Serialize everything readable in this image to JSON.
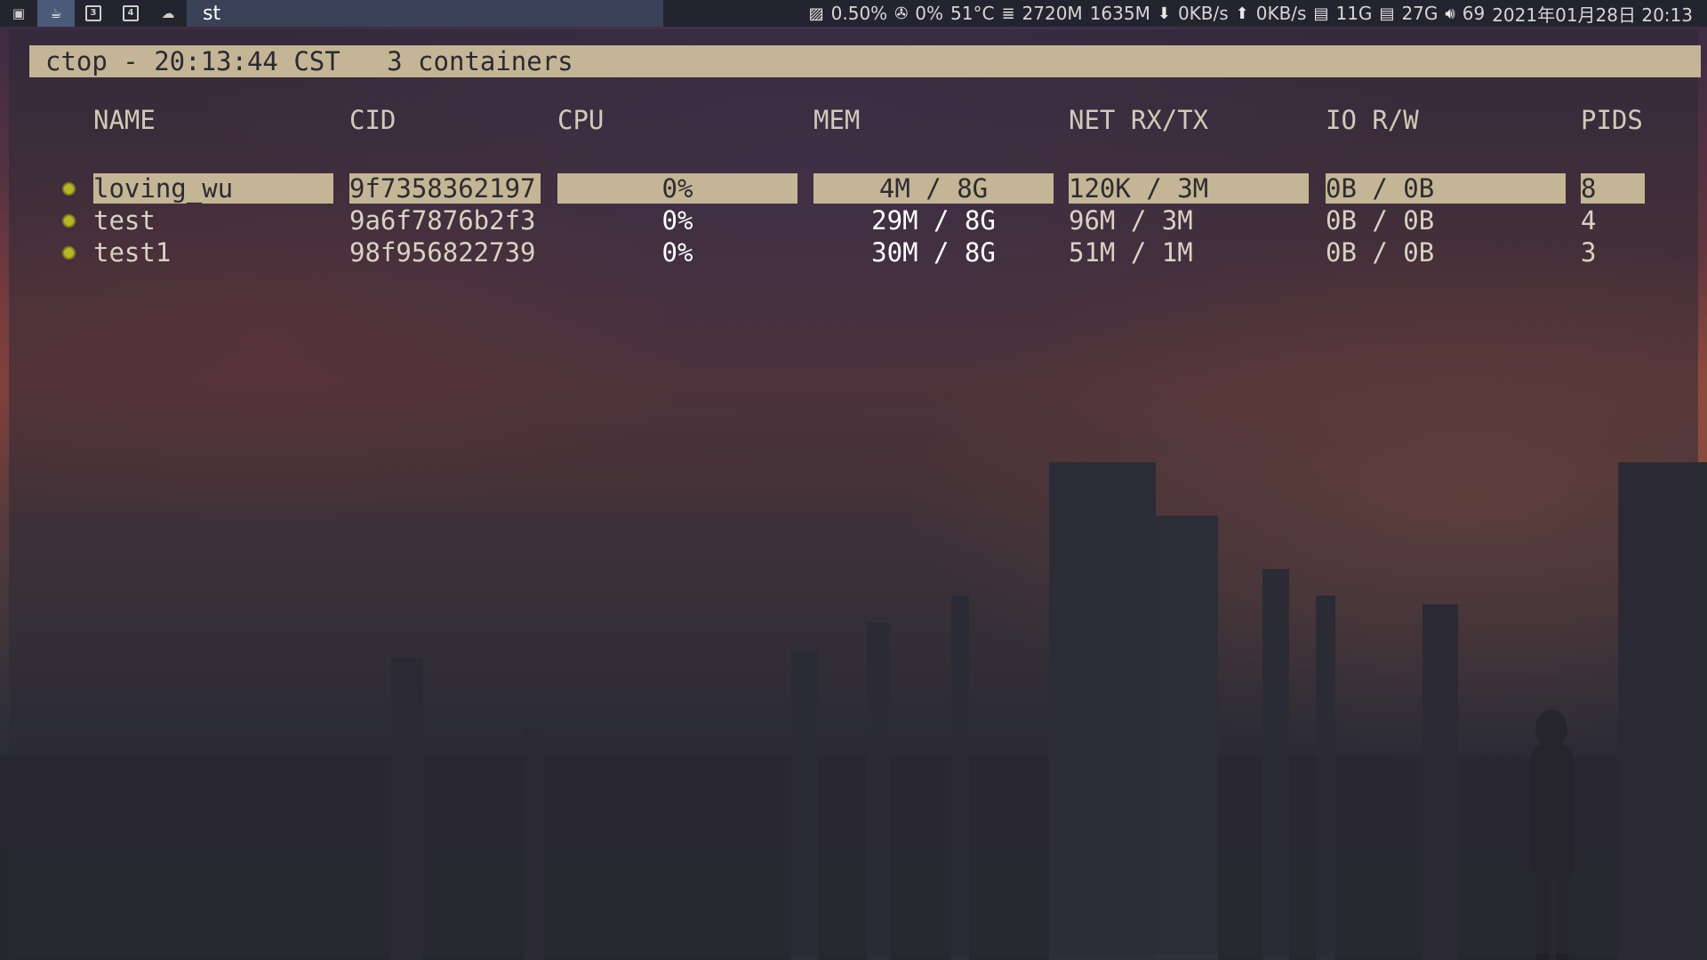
{
  "topbar": {
    "tags": [
      {
        "icon": "terminal-icon",
        "label": ""
      },
      {
        "icon": "coffee-icon",
        "label": "",
        "active": true
      },
      {
        "icon": "tag-3-icon",
        "label": "3"
      },
      {
        "icon": "tag-4-icon",
        "label": "4"
      },
      {
        "icon": "cloud-icon",
        "label": ""
      }
    ],
    "window_title": "st",
    "status": {
      "cpu": "0.50%",
      "fan": "0%",
      "temp": "51°C",
      "mem_used": "2720M",
      "mem_avail": "1635M",
      "net_down": "0KB/s",
      "net_up": "0KB/s",
      "disk1": "11G",
      "disk2": "27G",
      "volume": "69",
      "datetime": "2021年01月28日 20:13"
    }
  },
  "ctop": {
    "header": "ctop - 20:13:44 CST   3 containers",
    "columns": [
      "NAME",
      "CID",
      "CPU",
      "MEM",
      "NET RX/TX",
      "IO R/W",
      "PIDS"
    ],
    "rows": [
      {
        "name": "loving_wu",
        "cid": "9f7358362197",
        "cpu": "0%",
        "mem": "4M / 8G",
        "net": "120K / 3M",
        "io": "0B / 0B",
        "pids": "8",
        "selected": true
      },
      {
        "name": "test",
        "cid": "9a6f7876b2f3",
        "cpu": "0%",
        "mem": "29M / 8G",
        "net": "96M / 3M",
        "io": "0B / 0B",
        "pids": "4"
      },
      {
        "name": "test1",
        "cid": "98f956822739",
        "cpu": "0%",
        "mem": "30M / 8G",
        "net": "51M / 1M",
        "io": "0B / 0B",
        "pids": "3"
      }
    ],
    "colors": {
      "status_running": "#b7b52a",
      "highlight": "#c4b596"
    }
  }
}
